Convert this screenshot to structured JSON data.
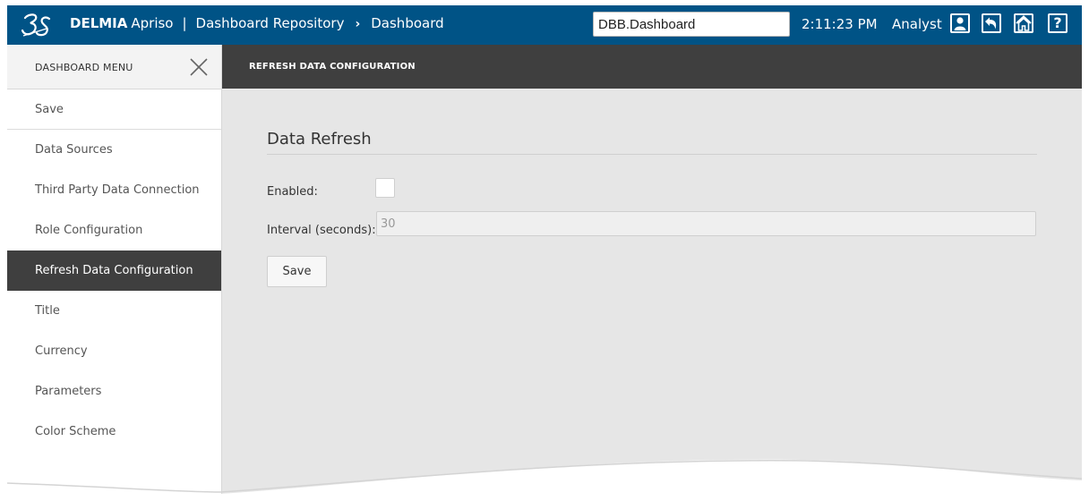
{
  "header": {
    "brand_bold": "DELMIA",
    "brand_light": "Apriso",
    "separator": "|",
    "breadcrumb": [
      "Dashboard Repository",
      "Dashboard"
    ],
    "breadcrumb_chevron": "›",
    "search_value": "DBB.Dashboard",
    "time": "2:11:23 PM",
    "user": "Analyst",
    "help_glyph": "?",
    "icons": [
      "user-icon",
      "back-icon",
      "home-icon",
      "help-icon"
    ],
    "bar_color": "#005386"
  },
  "sidebar": {
    "title": "DASHBOARD MENU",
    "items": [
      {
        "label": "Save"
      },
      {
        "label": "Data Sources"
      },
      {
        "label": "Third Party Data Connection"
      },
      {
        "label": "Role Configuration"
      },
      {
        "label": "Refresh Data Configuration",
        "active": true
      },
      {
        "label": "Title"
      },
      {
        "label": "Currency"
      },
      {
        "label": "Parameters"
      },
      {
        "label": "Color Scheme"
      }
    ]
  },
  "content": {
    "header_title": "REFRESH DATA CONFIGURATION",
    "section_title": "Data Refresh",
    "enabled_label": "Enabled:",
    "enabled_checked": false,
    "interval_label": "Interval (seconds):",
    "interval_value": "30",
    "save_label": "Save"
  }
}
